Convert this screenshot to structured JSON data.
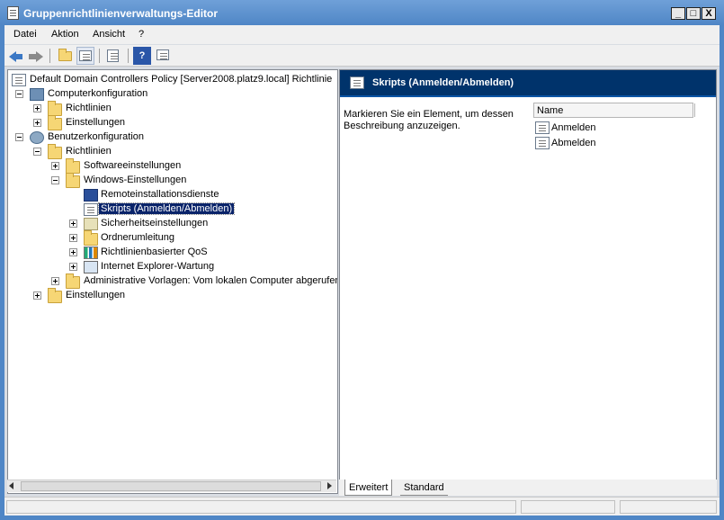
{
  "window": {
    "title": "Gruppenrichtlinienverwaltungs-Editor",
    "buttons": [
      "_",
      "□",
      "X"
    ]
  },
  "menu": [
    "Datei",
    "Aktion",
    "Ansicht",
    "?"
  ],
  "toolbar_icons": [
    "back-icon",
    "forward-icon",
    "up-folder-icon",
    "show-hide-tree-icon",
    "export-list-icon",
    "help-icon",
    "properties-icon"
  ],
  "tree": {
    "root": "Default Domain Controllers Policy [Server2008.platz9.local] Richtlinie",
    "computer_config": "Computerkonfiguration",
    "cc_policies": "Richtlinien",
    "cc_preferences": "Einstellungen",
    "user_config": "Benutzerkonfiguration",
    "uc_policies": "Richtlinien",
    "software_settings": "Softwareeinstellungen",
    "windows_settings": "Windows-Einstellungen",
    "remote_install": "Remoteinstallationsdienste",
    "scripts": "Skripts (Anmelden/Abmelden)",
    "security_settings": "Sicherheitseinstellungen",
    "folder_redirection": "Ordnerumleitung",
    "qos": "Richtlinienbasierter QoS",
    "ie_maintenance": "Internet Explorer-Wartung",
    "admin_templates": "Administrative Vorlagen: Vom lokalen Computer abgerufene",
    "uc_preferences": "Einstellungen"
  },
  "right_pane": {
    "title": "Skripts (Anmelden/Abmelden)",
    "description": "Markieren Sie ein Element, um dessen Beschreibung anzuzeigen.",
    "column_name": "Name",
    "items": [
      "Anmelden",
      "Abmelden"
    ]
  },
  "tabs": [
    "Erweitert",
    "Standard"
  ]
}
